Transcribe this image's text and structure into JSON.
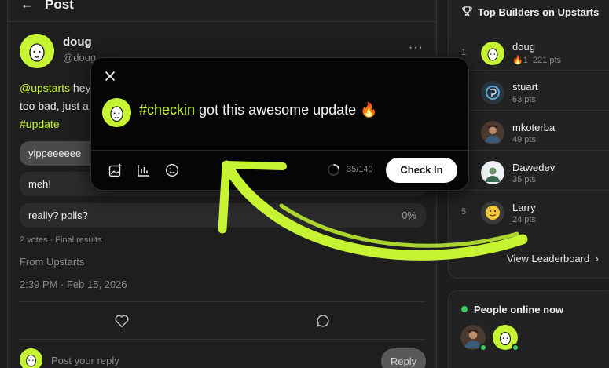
{
  "header": {
    "back_icon": "arrow-left-icon",
    "title": "Post"
  },
  "post": {
    "author_name": "doug",
    "author_handle": "@doug",
    "line1_mention": "@upstarts",
    "line1_rest": " hey",
    "line2": "too bad, just a",
    "hashtag": "#update",
    "poll": [
      {
        "label": "yippeeeeee",
        "percent": 100,
        "pct_label": ""
      },
      {
        "label": "meh!",
        "percent": 0,
        "pct_label": ""
      },
      {
        "label": "really? polls?",
        "percent": 0,
        "pct_label": "0%"
      }
    ],
    "votes_text": "2 votes · Final results",
    "from_text": "From Upstarts",
    "timestamp": "2:39 PM · Feb 15, 2026"
  },
  "reply": {
    "placeholder": "Post your reply",
    "button_label": "Reply"
  },
  "modal": {
    "hashtag": "#checkin",
    "text": " got this awesome update 🔥",
    "counter": "35/140",
    "counter_progress": 0.25,
    "submit_label": "Check In",
    "tools": [
      "image-add-icon",
      "poll-chart-icon",
      "emoji-icon"
    ]
  },
  "leaderboard": {
    "title": "Top Builders on Upstarts",
    "entries": [
      {
        "rank": "1",
        "name": "doug",
        "streak": "🔥1",
        "pts": "221 pts"
      },
      {
        "rank": "",
        "name": "stuart",
        "pts": "63 pts"
      },
      {
        "rank": "",
        "name": "mkoterba",
        "pts": "49 pts"
      },
      {
        "rank": "",
        "name": "Dawedev",
        "pts": "35 pts"
      },
      {
        "rank": "5",
        "name": "Larry",
        "pts": "24 pts"
      }
    ],
    "view_label": "View Leaderboard",
    "view_chevron": "›"
  },
  "online": {
    "title": "People online now"
  },
  "colors": {
    "accent": "#c6f432",
    "online": "#3ccb5b",
    "background": "#1d1d1d"
  }
}
